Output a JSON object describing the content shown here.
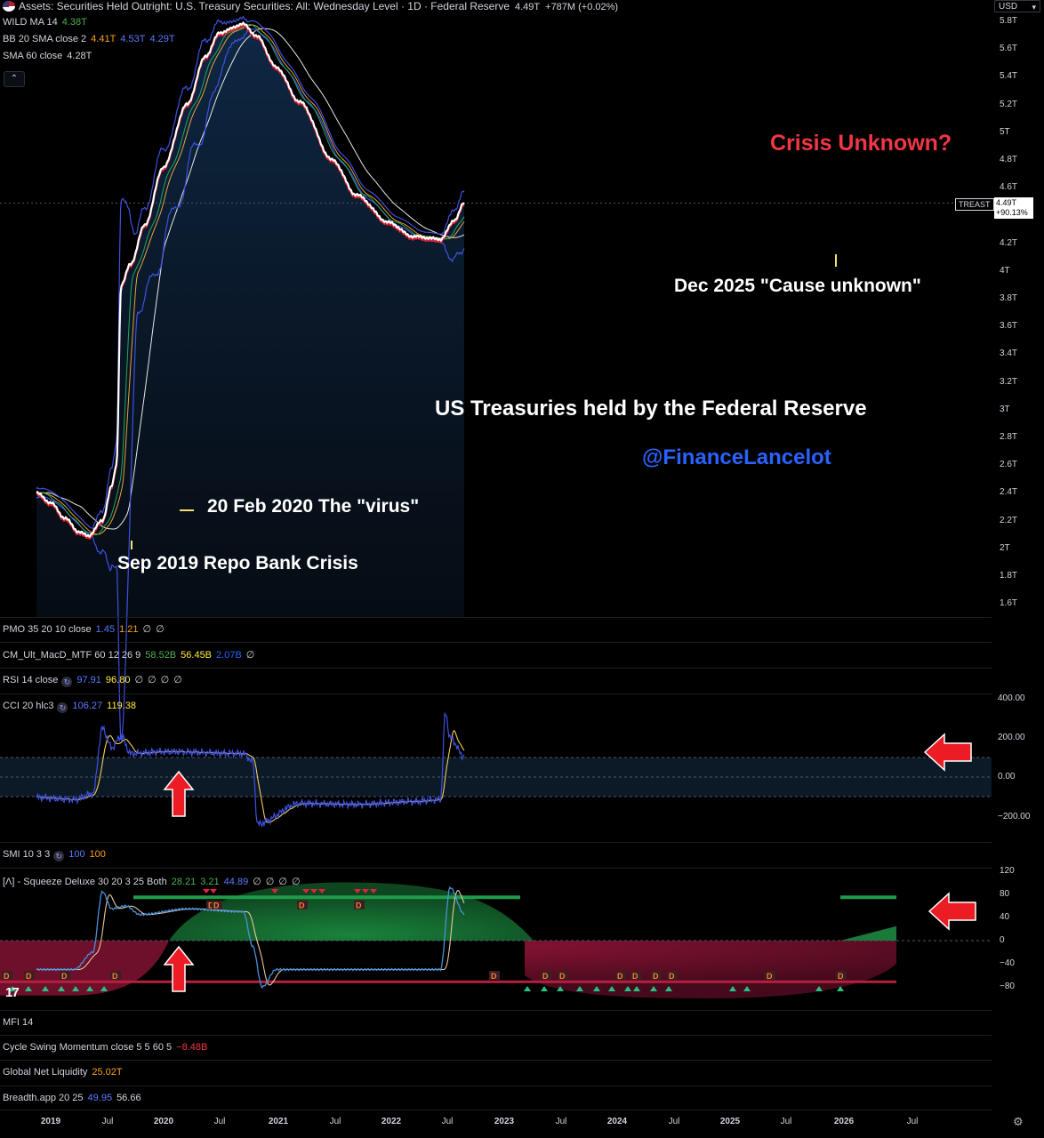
{
  "header": {
    "title": "Assets: Securities Held Outright: U.S. Treasury Securities: All: Wednesday Level · 1D · Federal Reserve",
    "value": "4.49T",
    "change": "+787M (+0.02%)",
    "currency": "USD"
  },
  "overlays": [
    {
      "label": "WILD MA 14",
      "values": [
        {
          "text": "4.38T",
          "color": "#4caf50"
        }
      ]
    },
    {
      "label": "BB 20 SMA close 2",
      "values": [
        {
          "text": "4.41T",
          "color": "#f7a21b"
        },
        {
          "text": "4.53T",
          "color": "#5b7bff"
        },
        {
          "text": "4.29T",
          "color": "#5b7bff"
        }
      ]
    },
    {
      "label": "SMA 60 close",
      "values": [
        {
          "text": "4.28T",
          "color": "#d1d4dc"
        }
      ]
    }
  ],
  "toggle_glyph": "⌃",
  "price_axis": [
    "5.8T",
    "5.6T",
    "5.4T",
    "5.2T",
    "5T",
    "4.8T",
    "4.6T",
    "4.2T",
    "4T",
    "3.8T",
    "3.6T",
    "3.4T",
    "3.2T",
    "3T",
    "2.8T",
    "2.6T",
    "2.4T",
    "2.2T",
    "2T",
    "1.8T",
    "1.6T"
  ],
  "price_tag": {
    "symbol": "TREAST",
    "value": "4.49T",
    "pct": "+90.13%"
  },
  "annotations": {
    "crisis": "Crisis Unknown?",
    "dec2025": "Dec 2025 \"Cause unknown\"",
    "title": "US Treasuries held by the Federal Reserve",
    "handle": "@FinanceLancelot",
    "feb2020": "20 Feb 2020 The \"virus\"",
    "sep2019": "Sep 2019 Repo Bank Crisis"
  },
  "indicators": {
    "pmo": {
      "label": "PMO 35 20 10 close",
      "values": [
        {
          "text": "1.45",
          "color": "#5b7bff"
        },
        {
          "text": "1.21",
          "color": "#f7a21b"
        },
        {
          "text": "∅",
          "color": "#d1d4dc"
        },
        {
          "text": "∅",
          "color": "#d1d4dc"
        }
      ]
    },
    "macd": {
      "label": "CM_Ult_MacD_MTF 60 12 26 9",
      "values": [
        {
          "text": "58.52B",
          "color": "#4caf50"
        },
        {
          "text": "56.45B",
          "color": "#ffeb3b"
        },
        {
          "text": "2.07B",
          "color": "#2962ff"
        },
        {
          "text": "∅",
          "color": "#d1d4dc"
        }
      ]
    },
    "rsi": {
      "label": "RSI 14 close",
      "values": [
        {
          "text": "97.91",
          "color": "#5b7bff"
        },
        {
          "text": "96.80",
          "color": "#ffeb3b"
        },
        {
          "text": "∅",
          "color": "#d1d4dc"
        },
        {
          "text": "∅",
          "color": "#d1d4dc"
        },
        {
          "text": "∅",
          "color": "#d1d4dc"
        },
        {
          "text": "∅",
          "color": "#d1d4dc"
        }
      ]
    },
    "cci": {
      "label": "CCI 20 hlc3",
      "values": [
        {
          "text": "106.27",
          "color": "#5b7bff"
        },
        {
          "text": "119.38",
          "color": "#ffeb3b"
        }
      ],
      "axis": [
        "400.00",
        "200.00",
        "0.00",
        "−200.00"
      ]
    },
    "smi": {
      "label": "SMI 10 3 3",
      "values": [
        {
          "text": "100",
          "color": "#5b7bff"
        },
        {
          "text": "100",
          "color": "#f7a21b"
        }
      ]
    },
    "squeeze": {
      "label": "[Λ] - Squeeze Deluxe 30 20 3 25 Both",
      "values": [
        {
          "text": "28.21",
          "color": "#4caf50"
        },
        {
          "text": "3.21",
          "color": "#4caf50"
        },
        {
          "text": "44.89",
          "color": "#5b7bff"
        },
        {
          "text": "∅",
          "color": "#d1d4dc"
        },
        {
          "text": "∅",
          "color": "#d1d4dc"
        },
        {
          "text": "∅",
          "color": "#d1d4dc"
        },
        {
          "text": "∅",
          "color": "#d1d4dc"
        }
      ],
      "axis": [
        "120",
        "80",
        "40",
        "0",
        "−40",
        "−80"
      ],
      "marker_text": "D"
    },
    "mfi": {
      "label": "MFI 14",
      "values": []
    },
    "csm": {
      "label": "Cycle Swing Momentum close 5 5 60 5",
      "values": [
        {
          "text": "−8.48B",
          "color": "#f23645"
        }
      ]
    },
    "gnl": {
      "label": "Global Net Liquidity",
      "values": [
        {
          "text": "25.02T",
          "color": "#f7a21b"
        }
      ]
    },
    "breadth": {
      "label": "Breadth.app 20 25",
      "values": [
        {
          "text": "49.95",
          "color": "#5b7bff"
        },
        {
          "text": "56.66",
          "color": "#d1d4dc"
        }
      ]
    }
  },
  "time_axis": [
    {
      "label": "2019",
      "year": true
    },
    {
      "label": "Jul",
      "year": false
    },
    {
      "label": "2020",
      "year": true
    },
    {
      "label": "Jul",
      "year": false
    },
    {
      "label": "2021",
      "year": true
    },
    {
      "label": "Jul",
      "year": false
    },
    {
      "label": "2022",
      "year": true
    },
    {
      "label": "Jul",
      "year": false
    },
    {
      "label": "2023",
      "year": true
    },
    {
      "label": "Jul",
      "year": false
    },
    {
      "label": "2024",
      "year": true
    },
    {
      "label": "Jul",
      "year": false
    },
    {
      "label": "2025",
      "year": true
    },
    {
      "label": "Jul",
      "year": false
    },
    {
      "label": "2026",
      "year": true
    },
    {
      "label": "Jul",
      "year": false
    }
  ],
  "logo": "17",
  "settings_icon": "⚙",
  "chart_data": {
    "type": "line",
    "main": {
      "x": [
        "2018-10",
        "2019-01",
        "2019-04",
        "2019-07",
        "2019-09",
        "2019-12",
        "2020-02",
        "2020-03",
        "2020-04",
        "2020-06",
        "2020-09",
        "2021-01",
        "2021-06",
        "2021-10",
        "2022-01",
        "2022-06",
        "2022-09",
        "2023-01",
        "2023-06",
        "2024-01",
        "2024-06",
        "2025-01",
        "2025-06",
        "2025-12",
        "2026-03",
        "2026-05"
      ],
      "y": [
        2.4,
        2.33,
        2.22,
        2.12,
        2.09,
        2.2,
        2.45,
        2.6,
        3.9,
        4.05,
        4.33,
        4.75,
        5.2,
        5.55,
        5.72,
        5.78,
        5.69,
        5.47,
        5.22,
        4.8,
        4.55,
        4.35,
        4.25,
        4.23,
        4.37,
        4.49
      ],
      "ylim": [
        1.55,
        5.85
      ],
      "unit": "T"
    },
    "cci": {
      "x": [
        "2018-10",
        "2019-06",
        "2019-10",
        "2019-12",
        "2020-02",
        "2020-04",
        "2020-06",
        "2021-01",
        "2022-06",
        "2022-08",
        "2022-09",
        "2023-06",
        "2024-06",
        "2025-06",
        "2025-12",
        "2026-01",
        "2026-02",
        "2026-05"
      ],
      "y": [
        -105,
        -115,
        -85,
        250,
        150,
        210,
        120,
        130,
        120,
        80,
        -240,
        -135,
        -140,
        -125,
        -115,
        330,
        200,
        105
      ],
      "ylim": [
        -300,
        400
      ]
    },
    "squeeze": {
      "x": [
        "2018-10",
        "2019-06",
        "2019-10",
        "2019-12",
        "2020-02",
        "2020-05",
        "2020-08",
        "2021-06",
        "2022-06",
        "2022-08",
        "2022-10",
        "2023-01",
        "2024-06",
        "2025-06",
        "2025-12",
        "2026-02",
        "2026-05"
      ],
      "y": [
        -50,
        -50,
        -20,
        85,
        55,
        60,
        45,
        55,
        50,
        -10,
        -80,
        -50,
        -50,
        -50,
        -50,
        92,
        46
      ],
      "ylim": [
        -100,
        120
      ]
    }
  }
}
